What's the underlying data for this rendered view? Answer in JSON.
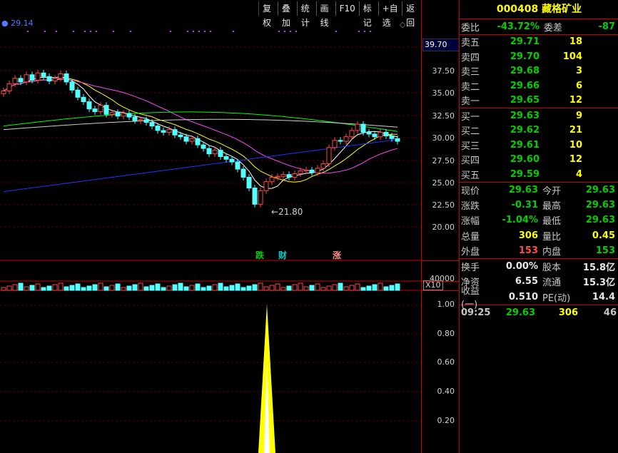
{
  "toolbar": {
    "items": [
      "复权",
      "叠加",
      "统计",
      "画线",
      "F10",
      "标记",
      "+自选",
      "返回"
    ]
  },
  "ma_legend": "29.14",
  "price_axis": {
    "current_box": "39.70",
    "ticks": [
      "37.50",
      "35.00",
      "32.50",
      "30.00",
      "27.50",
      "25.00",
      "22.50",
      "20.00"
    ]
  },
  "volume_axis": {
    "tick": "40000",
    "multiplier": "X10"
  },
  "indicator_axis": {
    "ticks": [
      "1.00",
      "0.80",
      "0.60",
      "0.40",
      "0.20"
    ]
  },
  "annotations": {
    "low_label": "21.80",
    "event_1": "跌",
    "event_2": "财",
    "event_3": "涨"
  },
  "stock": {
    "code": "000408",
    "name": "藏格矿业"
  },
  "order_ratio": {
    "label_ratio": "委比",
    "ratio": "-43.72%",
    "label_diff": "委差",
    "diff": "-87"
  },
  "asks": [
    {
      "label": "卖五",
      "price": "29.71",
      "volume": "18"
    },
    {
      "label": "卖四",
      "price": "29.70",
      "volume": "104"
    },
    {
      "label": "卖三",
      "price": "29.68",
      "volume": "3"
    },
    {
      "label": "卖二",
      "price": "29.66",
      "volume": "6"
    },
    {
      "label": "卖一",
      "price": "29.65",
      "volume": "12"
    }
  ],
  "bids": [
    {
      "label": "买一",
      "price": "29.63",
      "volume": "9"
    },
    {
      "label": "买二",
      "price": "29.62",
      "volume": "21"
    },
    {
      "label": "买三",
      "price": "29.61",
      "volume": "10"
    },
    {
      "label": "买四",
      "price": "29.60",
      "volume": "12"
    },
    {
      "label": "买五",
      "price": "29.59",
      "volume": "4"
    }
  ],
  "quote": [
    {
      "l1": "现价",
      "v1": "29.63",
      "c1": "green",
      "l2": "今开",
      "v2": "29.63",
      "c2": "green"
    },
    {
      "l1": "涨跌",
      "v1": "-0.31",
      "c1": "green",
      "l2": "最高",
      "v2": "29.63",
      "c2": "green"
    },
    {
      "l1": "涨幅",
      "v1": "-1.04%",
      "c1": "green",
      "l2": "最低",
      "v2": "29.63",
      "c2": "green"
    },
    {
      "l1": "总量",
      "v1": "306",
      "c1": "yellow",
      "l2": "量比",
      "v2": "0.45",
      "c2": "yellow"
    },
    {
      "l1": "外盘",
      "v1": "153",
      "c1": "red",
      "l2": "内盘",
      "v2": "153",
      "c2": "green"
    }
  ],
  "fundamentals": [
    {
      "l1": "换手",
      "v1": "0.00%",
      "l2": "股本",
      "v2": "15.8亿"
    },
    {
      "l1": "净资",
      "v1": "6.55",
      "l2": "流通",
      "v2": "15.3亿"
    },
    {
      "l1": "收益(一)",
      "v1": "0.510",
      "l2": "PE(动)",
      "v2": "14.4"
    }
  ],
  "tick_row": {
    "time": "09:25",
    "price": "29.63",
    "volume": "306",
    "count": "46"
  },
  "colors": {
    "up": "#ff4a4a",
    "down": "#54ffff",
    "ma5": "#ffffff",
    "ma10": "#ffff00",
    "ma20": "#ff44ff",
    "ma60": "#00ff00",
    "ma120": "#d0d0d0",
    "ma250": "#2233ff",
    "grid": "#5a0000",
    "border": "#cc0000"
  }
}
